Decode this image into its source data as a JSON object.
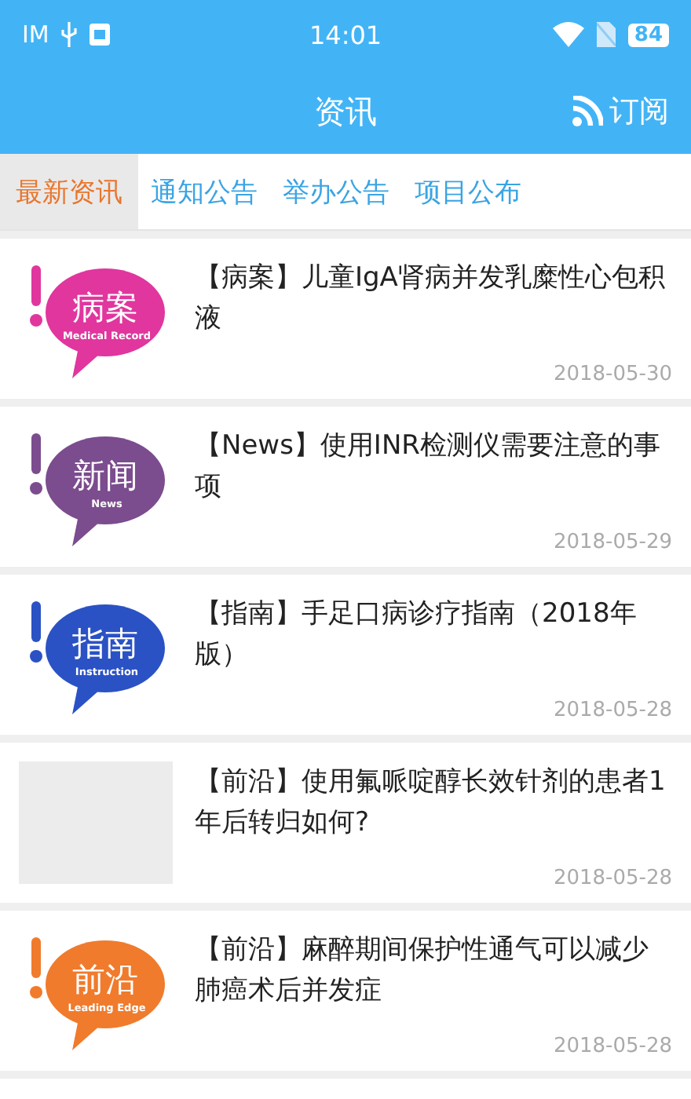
{
  "status_bar": {
    "carrier": "IM",
    "time": "14:01",
    "battery": "84"
  },
  "header": {
    "title": "资讯",
    "subscribe": "订阅"
  },
  "tabs": [
    {
      "label": "最新资讯",
      "selected": true
    },
    {
      "label": "通知公告",
      "selected": false
    },
    {
      "label": "举办公告",
      "selected": false
    },
    {
      "label": "项目公布",
      "selected": false
    }
  ],
  "articles": [
    {
      "thumb": {
        "kind": "logo",
        "text": "病案",
        "subtitle": "Medical Record",
        "color": "#e0369e"
      },
      "title": "【病案】儿童IgA肾病并发乳糜性心包积液",
      "date": "2018-05-30"
    },
    {
      "thumb": {
        "kind": "logo",
        "text": "新闻",
        "subtitle": "News",
        "color": "#7b4c8e"
      },
      "title": "【News】使用INR检测仪需要注意的事项",
      "date": "2018-05-29"
    },
    {
      "thumb": {
        "kind": "logo",
        "text": "指南",
        "subtitle": "Instruction",
        "color": "#2b52c4"
      },
      "title": "【指南】手足口病诊疗指南（2018年版）",
      "date": "2018-05-28"
    },
    {
      "thumb": {
        "kind": "blank"
      },
      "title": "【前沿】使用氟哌啶醇长效针剂的患者1年后转归如何?",
      "date": "2018-05-28"
    },
    {
      "thumb": {
        "kind": "logo",
        "text": "前沿",
        "subtitle": "Leading Edge",
        "color": "#f07b2c"
      },
      "title": "【前沿】麻醉期间保护性通气可以减少肺癌术后并发症",
      "date": "2018-05-28"
    }
  ]
}
